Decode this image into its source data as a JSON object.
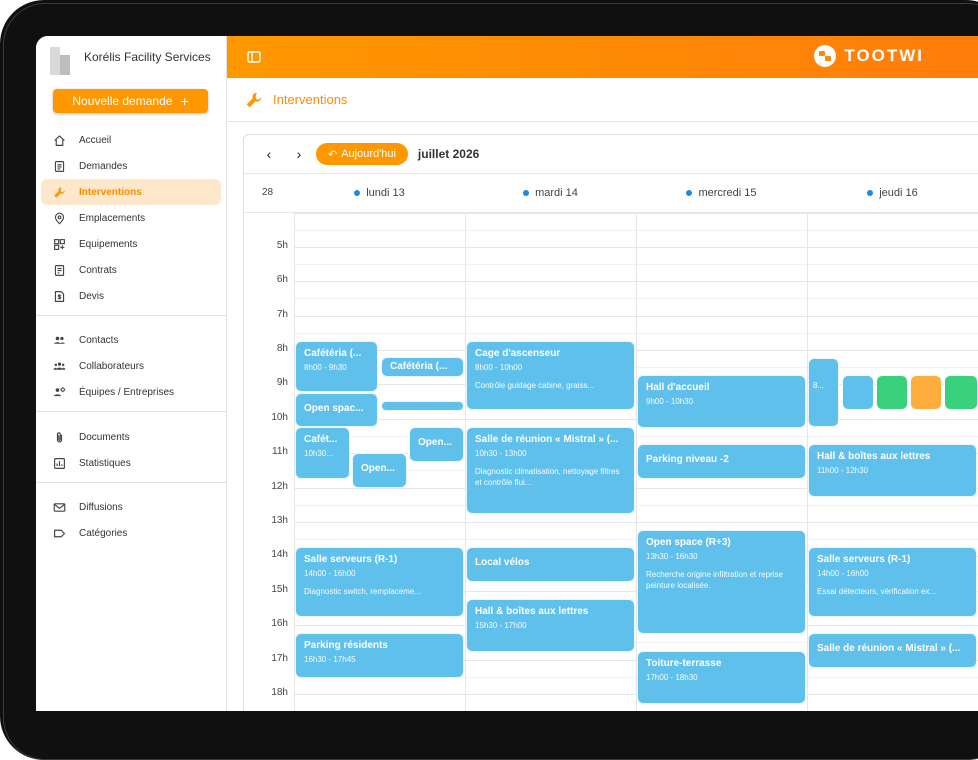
{
  "app": {
    "company": "Korélis Facility Services",
    "brand": "TOOTWI",
    "new_request": "Nouvelle demande",
    "new_request_icon": "+"
  },
  "sidebar": {
    "group1": [
      {
        "label": "Accueil",
        "icon": "home-icon"
      },
      {
        "label": "Demandes",
        "icon": "document-list-icon"
      },
      {
        "label": "Interventions",
        "icon": "wrench-icon",
        "active": true
      },
      {
        "label": "Emplacements",
        "icon": "location-pin-icon"
      },
      {
        "label": "Equipements",
        "icon": "grid-plus-icon"
      },
      {
        "label": "Contrats",
        "icon": "contract-icon"
      },
      {
        "label": "Devis",
        "icon": "quote-dollar-icon"
      }
    ],
    "group2": [
      {
        "label": "Contacts",
        "icon": "people-icon"
      },
      {
        "label": "Collaborateurs",
        "icon": "group-icon"
      },
      {
        "label": "Équipes / Entreprises",
        "icon": "team-gear-icon"
      }
    ],
    "group3": [
      {
        "label": "Documents",
        "icon": "paperclip-icon"
      },
      {
        "label": "Statistiques",
        "icon": "bar-chart-icon"
      }
    ],
    "group4": [
      {
        "label": "Diffusions",
        "icon": "mail-icon"
      },
      {
        "label": "Catégories",
        "icon": "tag-icon"
      }
    ]
  },
  "page": {
    "title": "Interventions"
  },
  "calendar": {
    "prev": "‹",
    "next": "›",
    "today_label": "Aujourd'hui",
    "month_label": "juillet 2026",
    "week_number": "28",
    "days": [
      "lundi 13",
      "mardi 14",
      "mercredi 15",
      "jeudi 16"
    ],
    "hours": [
      "5h",
      "6h",
      "7h",
      "8h",
      "9h",
      "10h",
      "11h",
      "12h",
      "13h",
      "14h",
      "15h",
      "16h",
      "17h",
      "18h"
    ],
    "colors": {
      "event": "#5fc0ec",
      "green": "#3ad17c",
      "orange": "#ffae3d",
      "accent": "#ff9800"
    },
    "events": {
      "mon_cafeteria1": {
        "title": "Cafétéria (...",
        "time": "8h00 - 9h30"
      },
      "mon_cafeteria2": {
        "title": "Cafétéria (..."
      },
      "mon_openspace1": {
        "title": "Open spac..."
      },
      "mon_cafeteria3": {
        "title": "Cafét...",
        "time": "10h30..."
      },
      "mon_open2": {
        "title": "Open..."
      },
      "mon_open3": {
        "title": "Open..."
      },
      "mon_salle_serveurs": {
        "title": "Salle serveurs (R-1)",
        "time": "14h00 - 16h00",
        "desc": "Diagnostic switch, remplaceme..."
      },
      "mon_parking": {
        "title": "Parking résidents",
        "time": "16h30 - 17h45"
      },
      "tue_ascenseur": {
        "title": "Cage d'ascenseur",
        "time": "8h00 - 10h00",
        "desc": "Contrôle guidage cabine, graiss..."
      },
      "tue_mistral": {
        "title": "Salle de réunion « Mistral » (...",
        "time": "10h30 - 13h00",
        "desc": "Diagnostic climatisation, nettoyage filtres et contrôle flui..."
      },
      "tue_velos": {
        "title": "Local vélos"
      },
      "tue_hall": {
        "title": "Hall & boîtes aux lettres",
        "time": "15h30 - 17h00"
      },
      "wed_hall_accueil": {
        "title": "Hall d'accueil",
        "time": "9h00 - 10h30"
      },
      "wed_parking": {
        "title": "Parking niveau -2"
      },
      "wed_openspace": {
        "title": "Open space (R+3)",
        "time": "13h30 - 16h30",
        "desc": "Recherche origine infiltration et reprise peinture localisée."
      },
      "wed_toiture": {
        "title": "Toiture-terrasse",
        "time": "17h00 - 18h30"
      },
      "thu_small": {
        "title": "8..."
      },
      "thu_hall": {
        "title": "Hall & boîtes aux lettres",
        "time": "11h00 - 12h30"
      },
      "thu_serveurs": {
        "title": "Salle serveurs (R-1)",
        "time": "14h00 - 16h00",
        "desc": "Essai détecteurs, vérification ex..."
      },
      "thu_mistral": {
        "title": "Salle de réunion « Mistral » (..."
      }
    }
  }
}
